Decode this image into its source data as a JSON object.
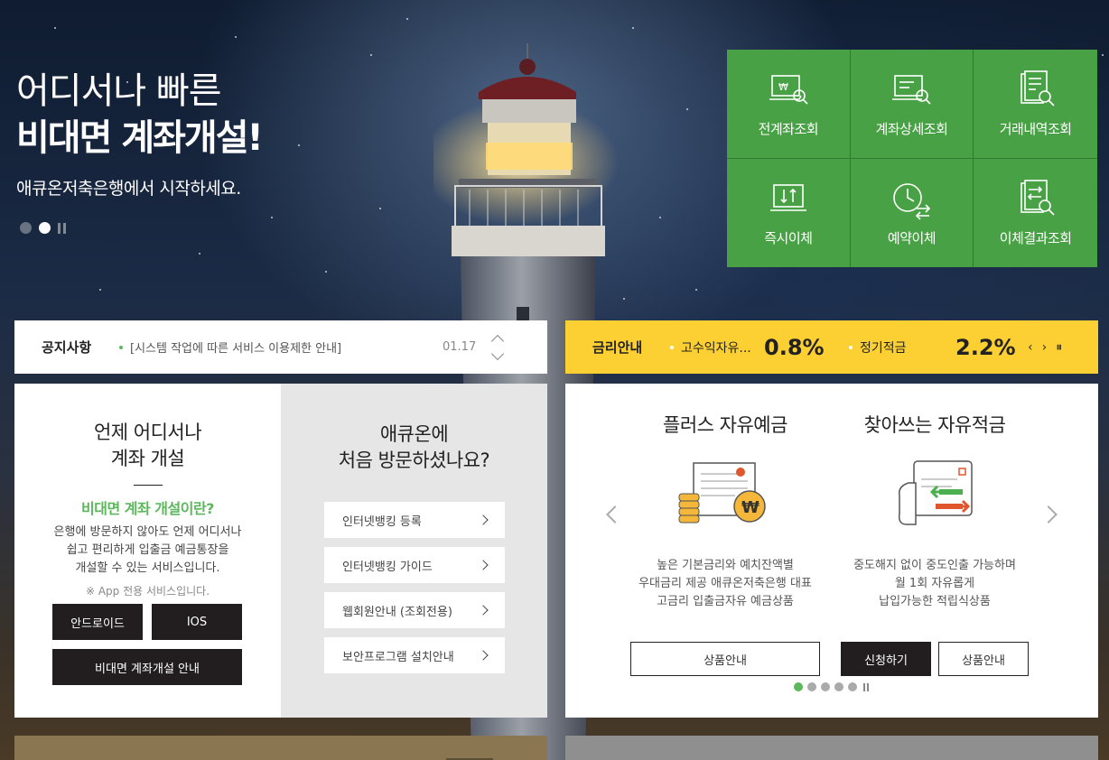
{
  "hero": {
    "title_line1": "어디서나 빠른",
    "title_line2": "비대면 계좌개설!",
    "subtitle": "애큐온저축은행에서 시작하세요."
  },
  "quick_menu": [
    {
      "label": "전계좌조회",
      "icon": "account-search-icon"
    },
    {
      "label": "계좌상세조회",
      "icon": "account-detail-icon"
    },
    {
      "label": "거래내역조회",
      "icon": "history-search-icon"
    },
    {
      "label": "즉시이체",
      "icon": "transfer-icon"
    },
    {
      "label": "예약이체",
      "icon": "scheduled-transfer-icon"
    },
    {
      "label": "이체결과조회",
      "icon": "transfer-result-icon"
    }
  ],
  "notice": {
    "title": "공지사항",
    "text": "[시스템 작업에 따른 서비스 이용제한 안내]",
    "date": "01.17"
  },
  "rates": {
    "title": "금리안내",
    "items": [
      {
        "name": "고수익자유...",
        "value": "0.8%"
      },
      {
        "name": "정기적금",
        "value": "2.2%"
      }
    ]
  },
  "account_open": {
    "heading_line1": "언제 어디서나",
    "heading_line2": "계좌 개설",
    "highlight": "비대면 계좌 개설이란?",
    "desc_line1": "은행에 방문하지 않아도 언제 어디서나",
    "desc_line2": "쉽고 편리하게 입출금 예금통장을",
    "desc_line3": "개설할 수 있는 서비스입니다.",
    "note": "※ App 전용 서비스입니다.",
    "android_label": "안드로이드",
    "ios_label": "IOS",
    "guide_label": "비대면 계좌개설 안내"
  },
  "first_visit": {
    "heading_line1": "애큐온에",
    "heading_line2": "처음 방문하셨나요?",
    "links": [
      "인터넷뱅킹 등록",
      "인터넷뱅킹 가이드",
      "웹회원안내 (조회전용)",
      "보안프로그램 설치안내"
    ]
  },
  "products": [
    {
      "title": "플러스 자유예금",
      "desc_line1": "높은 기본금리와 예치잔액별",
      "desc_line2": "우대금리 제공 애큐온저축은행 대표",
      "desc_line3": "고금리 입출금자유 예금상품",
      "info_label": "상품안내"
    },
    {
      "title": "찾아쓰는 자유적금",
      "desc_line1": "중도해지 없이 중도인출 가능하며",
      "desc_line2": "월 1회 자유롭게",
      "desc_line3": "납입가능한 적립식상품",
      "apply_label": "신청하기",
      "info_label": "상품안내"
    }
  ],
  "colors": {
    "green": "#48a245",
    "yellow": "#fcd033",
    "dark": "#221e1f",
    "accent_green": "#5cb85c"
  }
}
